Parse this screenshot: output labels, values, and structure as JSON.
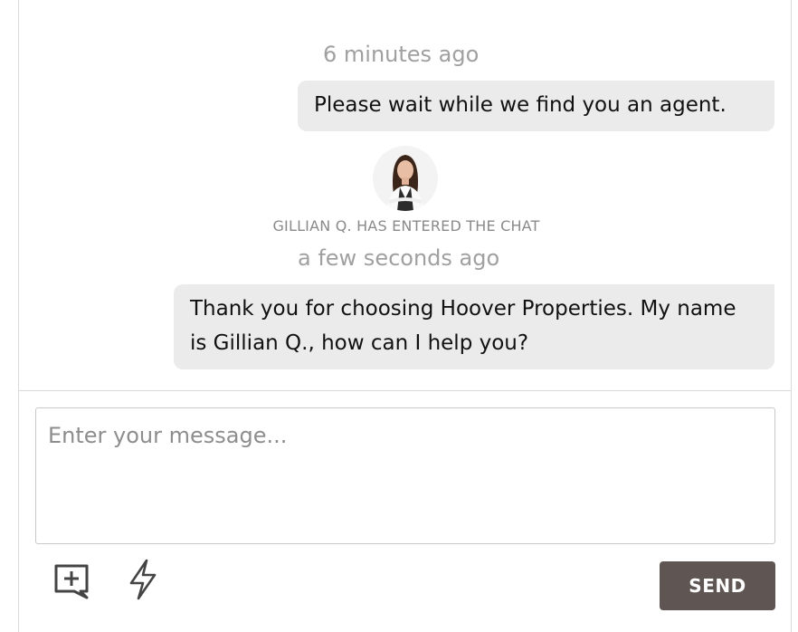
{
  "messages": [
    {
      "timestamp": "6 minutes ago",
      "text": "Please wait while we find you an agent."
    },
    {
      "timestamp": "a few seconds ago",
      "text": "Thank you for choosing Hoover Properties. My name is Gillian Q., how can I help you?"
    }
  ],
  "system_event": {
    "avatar_icon": "agent-avatar",
    "text": "GILLIAN Q. HAS ENTERED THE CHAT"
  },
  "composer": {
    "placeholder": "Enter your message...",
    "value": "",
    "add_attachment_icon": "message-plus-icon",
    "quick_reply_icon": "lightning-bolt-icon",
    "send_label": "SEND"
  },
  "colors": {
    "bubble_bg": "#ebebeb",
    "send_button_bg": "#5f5653",
    "timestamp_text": "#a0a0a0"
  }
}
